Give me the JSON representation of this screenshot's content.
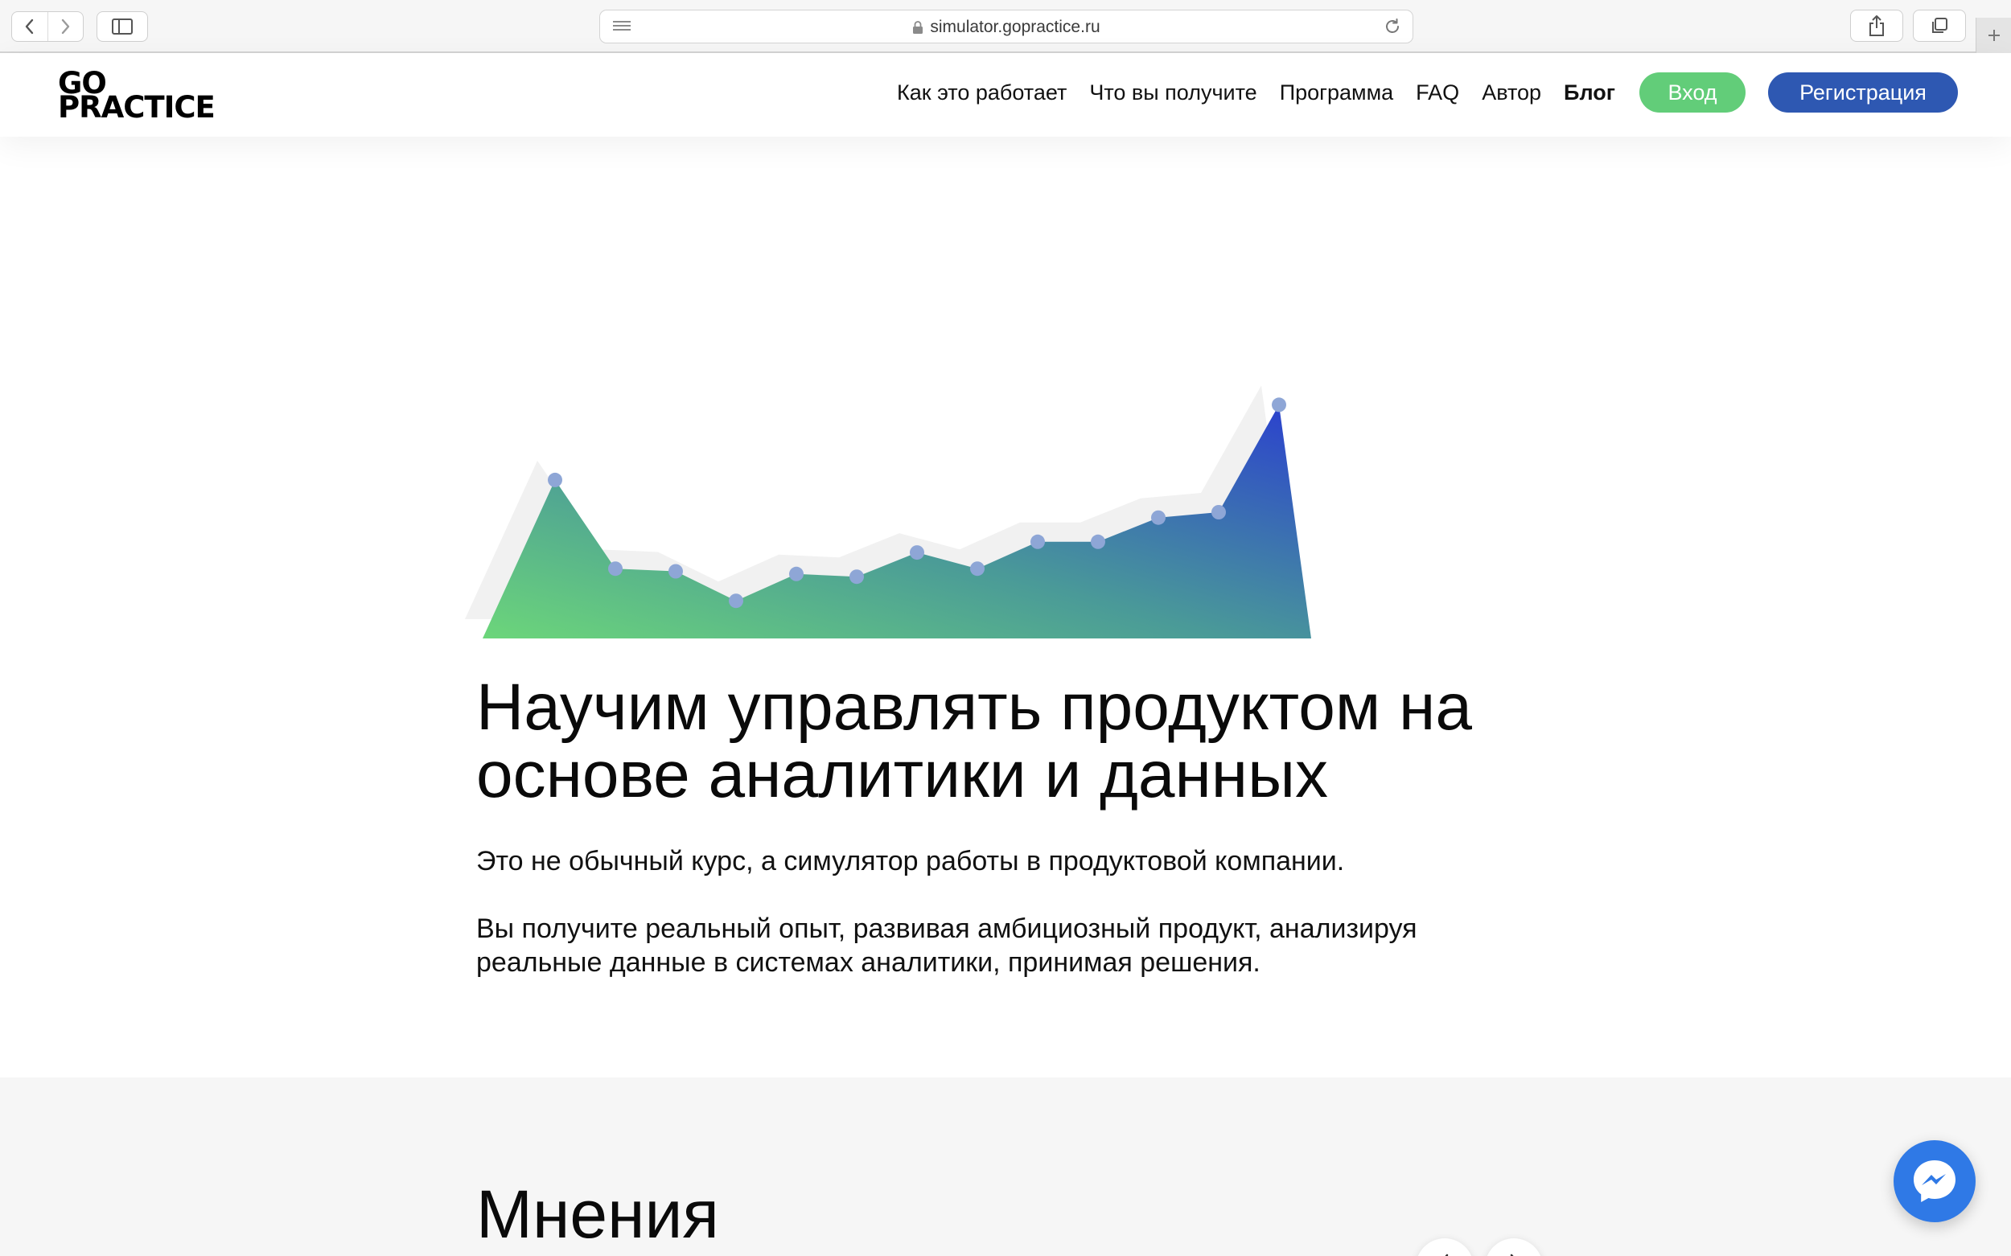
{
  "browser": {
    "url": "simulator.gopractice.ru",
    "icons": {
      "back": "chevron-left-icon",
      "forward": "chevron-right-icon",
      "sidebar": "sidebar-icon",
      "reader": "reader-menu-icon",
      "lock": "lock-icon",
      "reload": "reload-icon",
      "share": "share-icon",
      "tabs": "tabs-overview-icon",
      "new_tab": "plus-icon"
    }
  },
  "header": {
    "logo_line1": "GO",
    "logo_line2": "PRACTICE",
    "nav": [
      {
        "label": "Как это работает"
      },
      {
        "label": "Что вы получите"
      },
      {
        "label": "Программа"
      },
      {
        "label": "FAQ"
      },
      {
        "label": "Автор"
      },
      {
        "label": "Блог"
      }
    ],
    "login_label": "Вход",
    "register_label": "Регистрация"
  },
  "hero": {
    "title": "Научим управлять продуктом на основе аналитики и данных",
    "paragraph1": "Это не обычный курс, а симулятор работы в продуктовой компании.",
    "paragraph2": "Вы получите реальный опыт, развивая амбициозный продукт, анализируя реальные данные в системах аналитики, принимая решения."
  },
  "opinions": {
    "title": "Мнения",
    "prev_icon": "chevron-left-icon",
    "next_icon": "chevron-right-icon"
  },
  "messenger": {
    "icon": "messenger-icon"
  },
  "colors": {
    "login_green": "#62cd79",
    "register_blue": "#2e58b2",
    "chart_gradient_start": "#6cd67a",
    "chart_gradient_end": "#2a3fcf",
    "chart_points": "#8ea6d6",
    "messenger_blue": "#2f79e6"
  },
  "chart_data": {
    "type": "area",
    "x": [
      0,
      1,
      2,
      3,
      4,
      5,
      6,
      7,
      8,
      9,
      10,
      11,
      12
    ],
    "series": [
      {
        "values": [
          59,
          26,
          25,
          14,
          24,
          23,
          32,
          26,
          36,
          36,
          45,
          47,
          87
        ]
      }
    ],
    "ylim": [
      0,
      100
    ],
    "grid": false,
    "legend": "none",
    "title": "",
    "xlabel": "",
    "ylabel": ""
  }
}
